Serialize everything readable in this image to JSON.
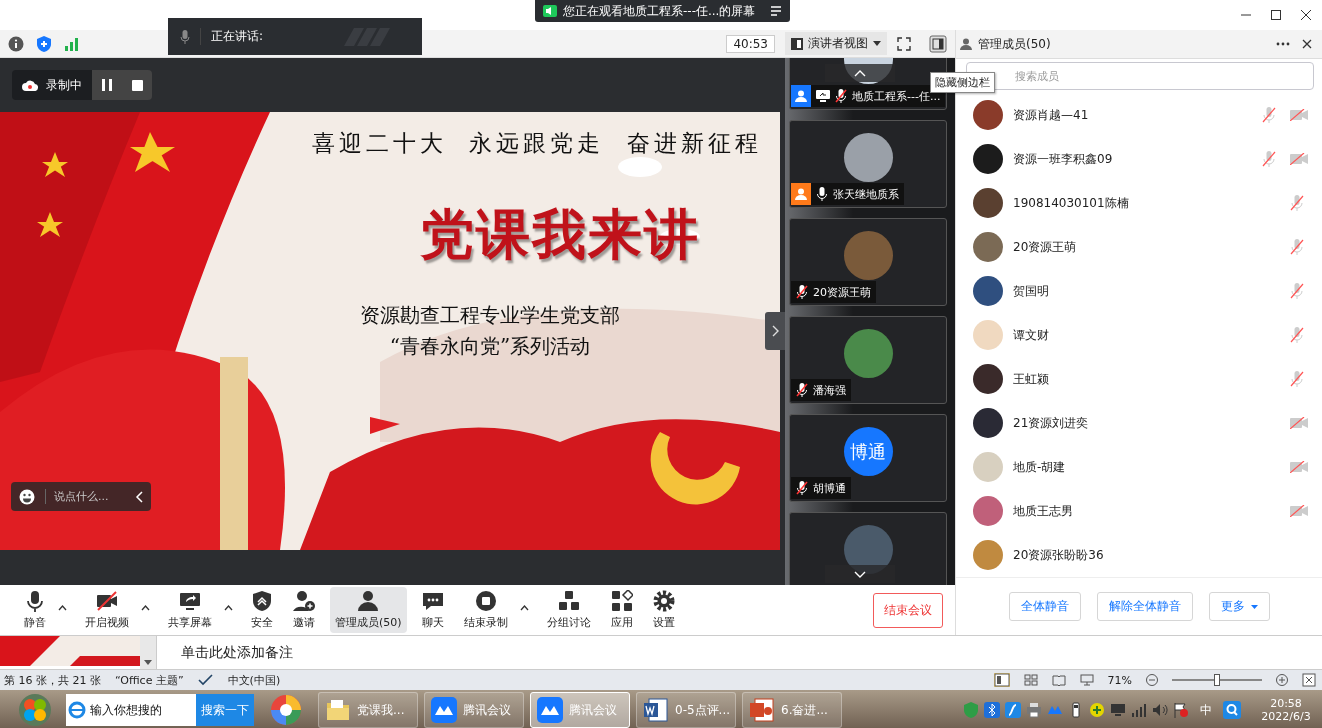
{
  "notification": {
    "text": "您正在观看地质工程系---任...的屏幕"
  },
  "speaking": {
    "label": "正在讲话:"
  },
  "timer": "40:53",
  "view_button": {
    "label": "演讲者视图"
  },
  "tooltip": "隐藏侧边栏",
  "recording": {
    "label": "录制中"
  },
  "slide": {
    "slogan": "喜迎二十大  永远跟党走  奋进新征程",
    "title": "党课我来讲",
    "subtitle": [
      "资源勘查工程专业学生党支部",
      "“青春永向党”系列活动"
    ]
  },
  "chat_input": {
    "placeholder": "说点什么..."
  },
  "video_tiles": [
    {
      "name": "地质工程系---任...",
      "kind": "host",
      "sharing": true,
      "mic_muted": true
    },
    {
      "name": "张天继地质系",
      "kind": "cohost",
      "sharing": false,
      "mic_muted": false
    },
    {
      "name": "20资源王萌",
      "kind": "member",
      "sharing": false,
      "mic_muted": true
    },
    {
      "name": "潘海强",
      "kind": "member",
      "sharing": false,
      "mic_muted": true
    },
    {
      "name": "胡博通",
      "kind": "member",
      "sharing": false,
      "mic_muted": true,
      "avatar_text": "博通"
    },
    {
      "sharing": false
    }
  ],
  "toolbar": [
    {
      "label": "静音",
      "kind": "mic",
      "caret": true,
      "selected": false
    },
    {
      "label": "开启视频",
      "kind": "video",
      "caret": true,
      "selected": false
    },
    {
      "label": "共享屏幕",
      "kind": "share",
      "caret": true,
      "selected": false
    },
    {
      "label": "安全",
      "kind": "security",
      "caret": false,
      "selected": false
    },
    {
      "label": "邀请",
      "kind": "invite",
      "caret": false,
      "selected": false
    },
    {
      "label": "管理成员(50)",
      "kind": "members",
      "caret": false,
      "selected": true
    },
    {
      "label": "聊天",
      "kind": "chat",
      "caret": false,
      "selected": false
    },
    {
      "label": "结束录制",
      "kind": "record",
      "caret": true,
      "selected": false
    },
    {
      "label": "分组讨论",
      "kind": "breakout",
      "caret": false,
      "selected": false
    },
    {
      "label": "应用",
      "kind": "apps",
      "caret": false,
      "selected": false
    },
    {
      "label": "设置",
      "kind": "settings",
      "caret": false,
      "selected": false
    }
  ],
  "end_button": "结束会议",
  "members_panel": {
    "title": "管理成员(50)",
    "search_placeholder": "搜索成员",
    "members": [
      {
        "name": "资源肖越—41",
        "mic_off": true,
        "camera_off": true
      },
      {
        "name": "资源一班李积鑫09",
        "mic_off": true,
        "camera_off": true
      },
      {
        "name": "190814030101陈楠",
        "mic_off": true,
        "camera_off": false
      },
      {
        "name": "20资源王萌",
        "mic_off": true,
        "camera_off": false
      },
      {
        "name": "贺国明",
        "mic_off": true,
        "camera_off": false
      },
      {
        "name": "谭文财",
        "mic_off": true,
        "camera_off": false
      },
      {
        "name": "王虹颍",
        "mic_off": true,
        "camera_off": false
      },
      {
        "name": "21资源刘进奕",
        "mic_off": false,
        "camera_off": true
      },
      {
        "name": "地质-胡建",
        "mic_off": false,
        "camera_off": true
      },
      {
        "name": "地质王志男",
        "mic_off": false,
        "camera_off": true
      },
      {
        "name": "20资源张盼盼36",
        "mic_off": false,
        "camera_off": false
      }
    ],
    "actions": [
      "全体静音",
      "解除全体静音",
      "更多"
    ]
  },
  "ppt": {
    "notes_placeholder": "单击此处添加备注",
    "status": {
      "slide_info": "第 16 张，共 21 张",
      "theme": "“Office 主题”",
      "language": "中文(中国)",
      "zoom": "71%",
      "level": 0.5
    }
  },
  "taskbar": {
    "search_placeholder": "输入你想搜的",
    "search_button": "搜索一下",
    "apps": [
      {
        "label": "党课我...",
        "kind": "folder",
        "selected": false
      },
      {
        "label": "腾讯会议",
        "kind": "meeting",
        "selected": false
      },
      {
        "label": "腾讯会议",
        "kind": "meeting",
        "selected": true
      },
      {
        "label": "0-5点评...",
        "kind": "document",
        "selected": false
      },
      {
        "label": "6.奋进...",
        "kind": "presentation",
        "selected": false
      }
    ],
    "ime": "中",
    "time": "20:58",
    "date": "2022/6/3"
  }
}
